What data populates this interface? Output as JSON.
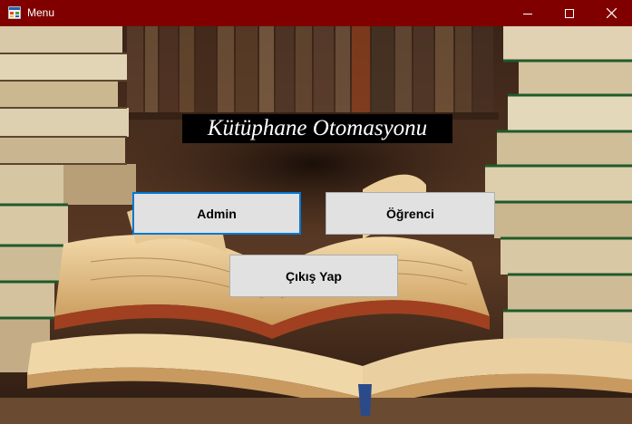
{
  "window": {
    "title": "Menu",
    "controls": {
      "minimize": "minimize-icon",
      "maximize": "maximize-icon",
      "close": "close-icon"
    },
    "titlebar_color": "#800000"
  },
  "main": {
    "heading": "Kütüphane Otomasyonu",
    "buttons": {
      "admin": "Admin",
      "student": "Öğrenci",
      "exit": "Çıkış Yap"
    },
    "focused_button": "admin",
    "background": "books-photo"
  }
}
